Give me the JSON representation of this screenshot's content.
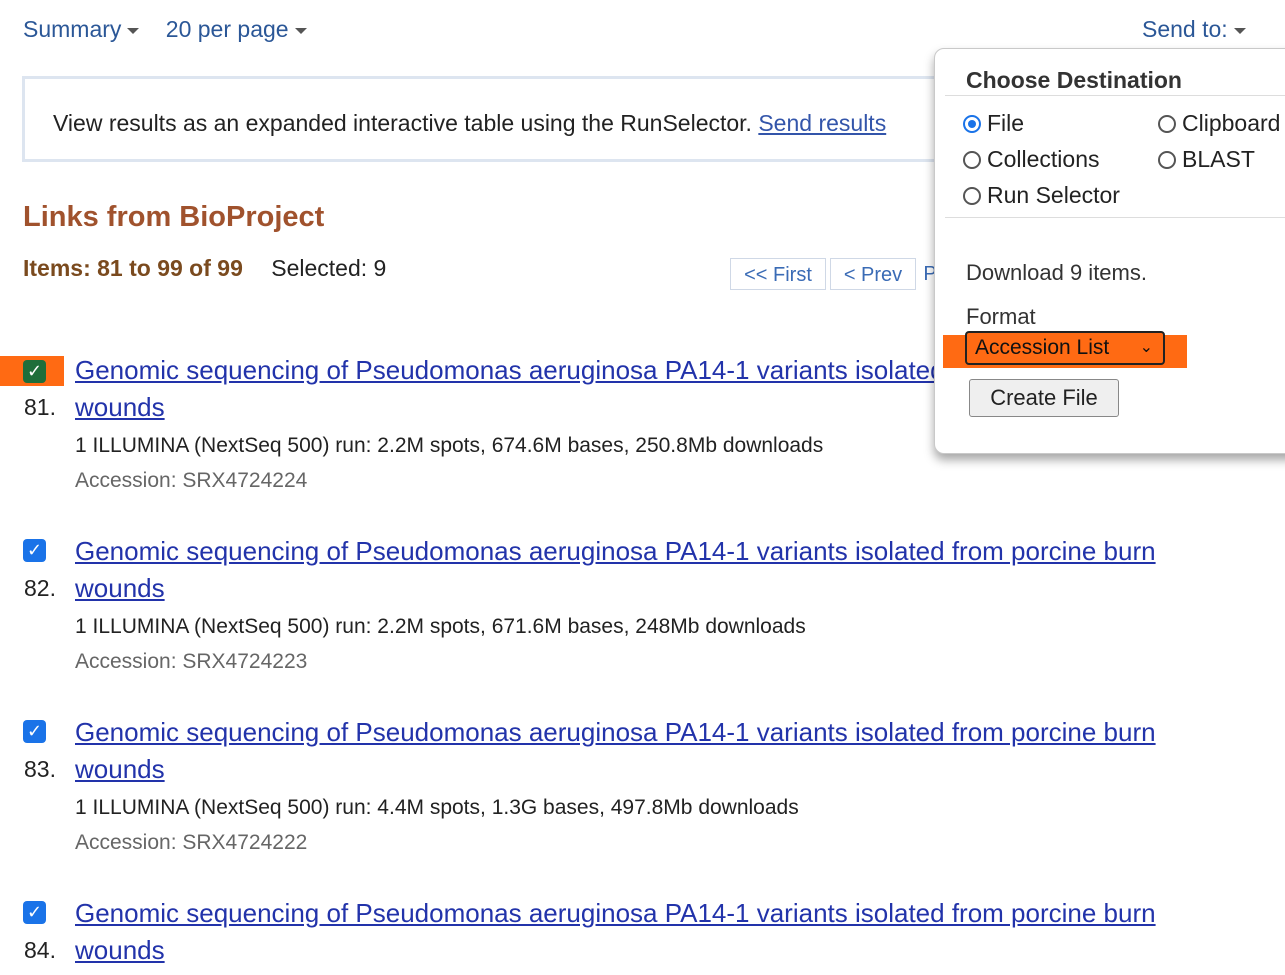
{
  "toolbar": {
    "summary_label": "Summary",
    "per_page_label": "20 per page",
    "send_to_label": "Send to:"
  },
  "info_box": {
    "text": "View results as an expanded interactive table using the RunSelector. ",
    "link": "Send results"
  },
  "heading": "Links from BioProject",
  "items_count": "Items: 81 to 99 of 99",
  "selected": "Selected: 9",
  "pager": {
    "first": "<< First",
    "prev": "< Prev",
    "partial": "P"
  },
  "results": [
    {
      "number": "81.",
      "title": "Genomic sequencing of Pseudomonas aeruginosa PA14-1 variants isolated from porcine burn wounds",
      "description": "1 ILLUMINA (NextSeq 500) run: 2.2M spots, 674.6M bases, 250.8Mb downloads",
      "accession": "Accession: SRX4724224",
      "checked": true
    },
    {
      "number": "82.",
      "title": "Genomic sequencing of Pseudomonas aeruginosa PA14-1 variants isolated from porcine burn wounds",
      "description": "1 ILLUMINA (NextSeq 500) run: 2.2M spots, 671.6M bases, 248Mb downloads",
      "accession": "Accession: SRX4724223",
      "checked": true
    },
    {
      "number": "83.",
      "title": "Genomic sequencing of Pseudomonas aeruginosa PA14-1 variants isolated from porcine burn wounds",
      "description": "1 ILLUMINA (NextSeq 500) run: 4.4M spots, 1.3G bases, 497.8Mb downloads",
      "accession": "Accession: SRX4724222",
      "checked": true
    },
    {
      "number": "84.",
      "title": "Genomic sequencing of Pseudomonas aeruginosa PA14-1 variants isolated from porcine burn wounds",
      "description": "",
      "accession": "",
      "checked": true
    }
  ],
  "popup": {
    "title": "Choose Destination",
    "options": {
      "file": "File",
      "clipboard": "Clipboard",
      "collections": "Collections",
      "blast": "BLAST",
      "run_selector": "Run Selector"
    },
    "selected_option": "File",
    "download_text": "Download 9 items.",
    "format_label": "Format",
    "format_value": "Accession List",
    "create_button": "Create File"
  },
  "colors": {
    "link": "#2233aa",
    "heading": "#a0522d",
    "highlight": "#ff6a13",
    "checkbox": "#1a73e8"
  }
}
